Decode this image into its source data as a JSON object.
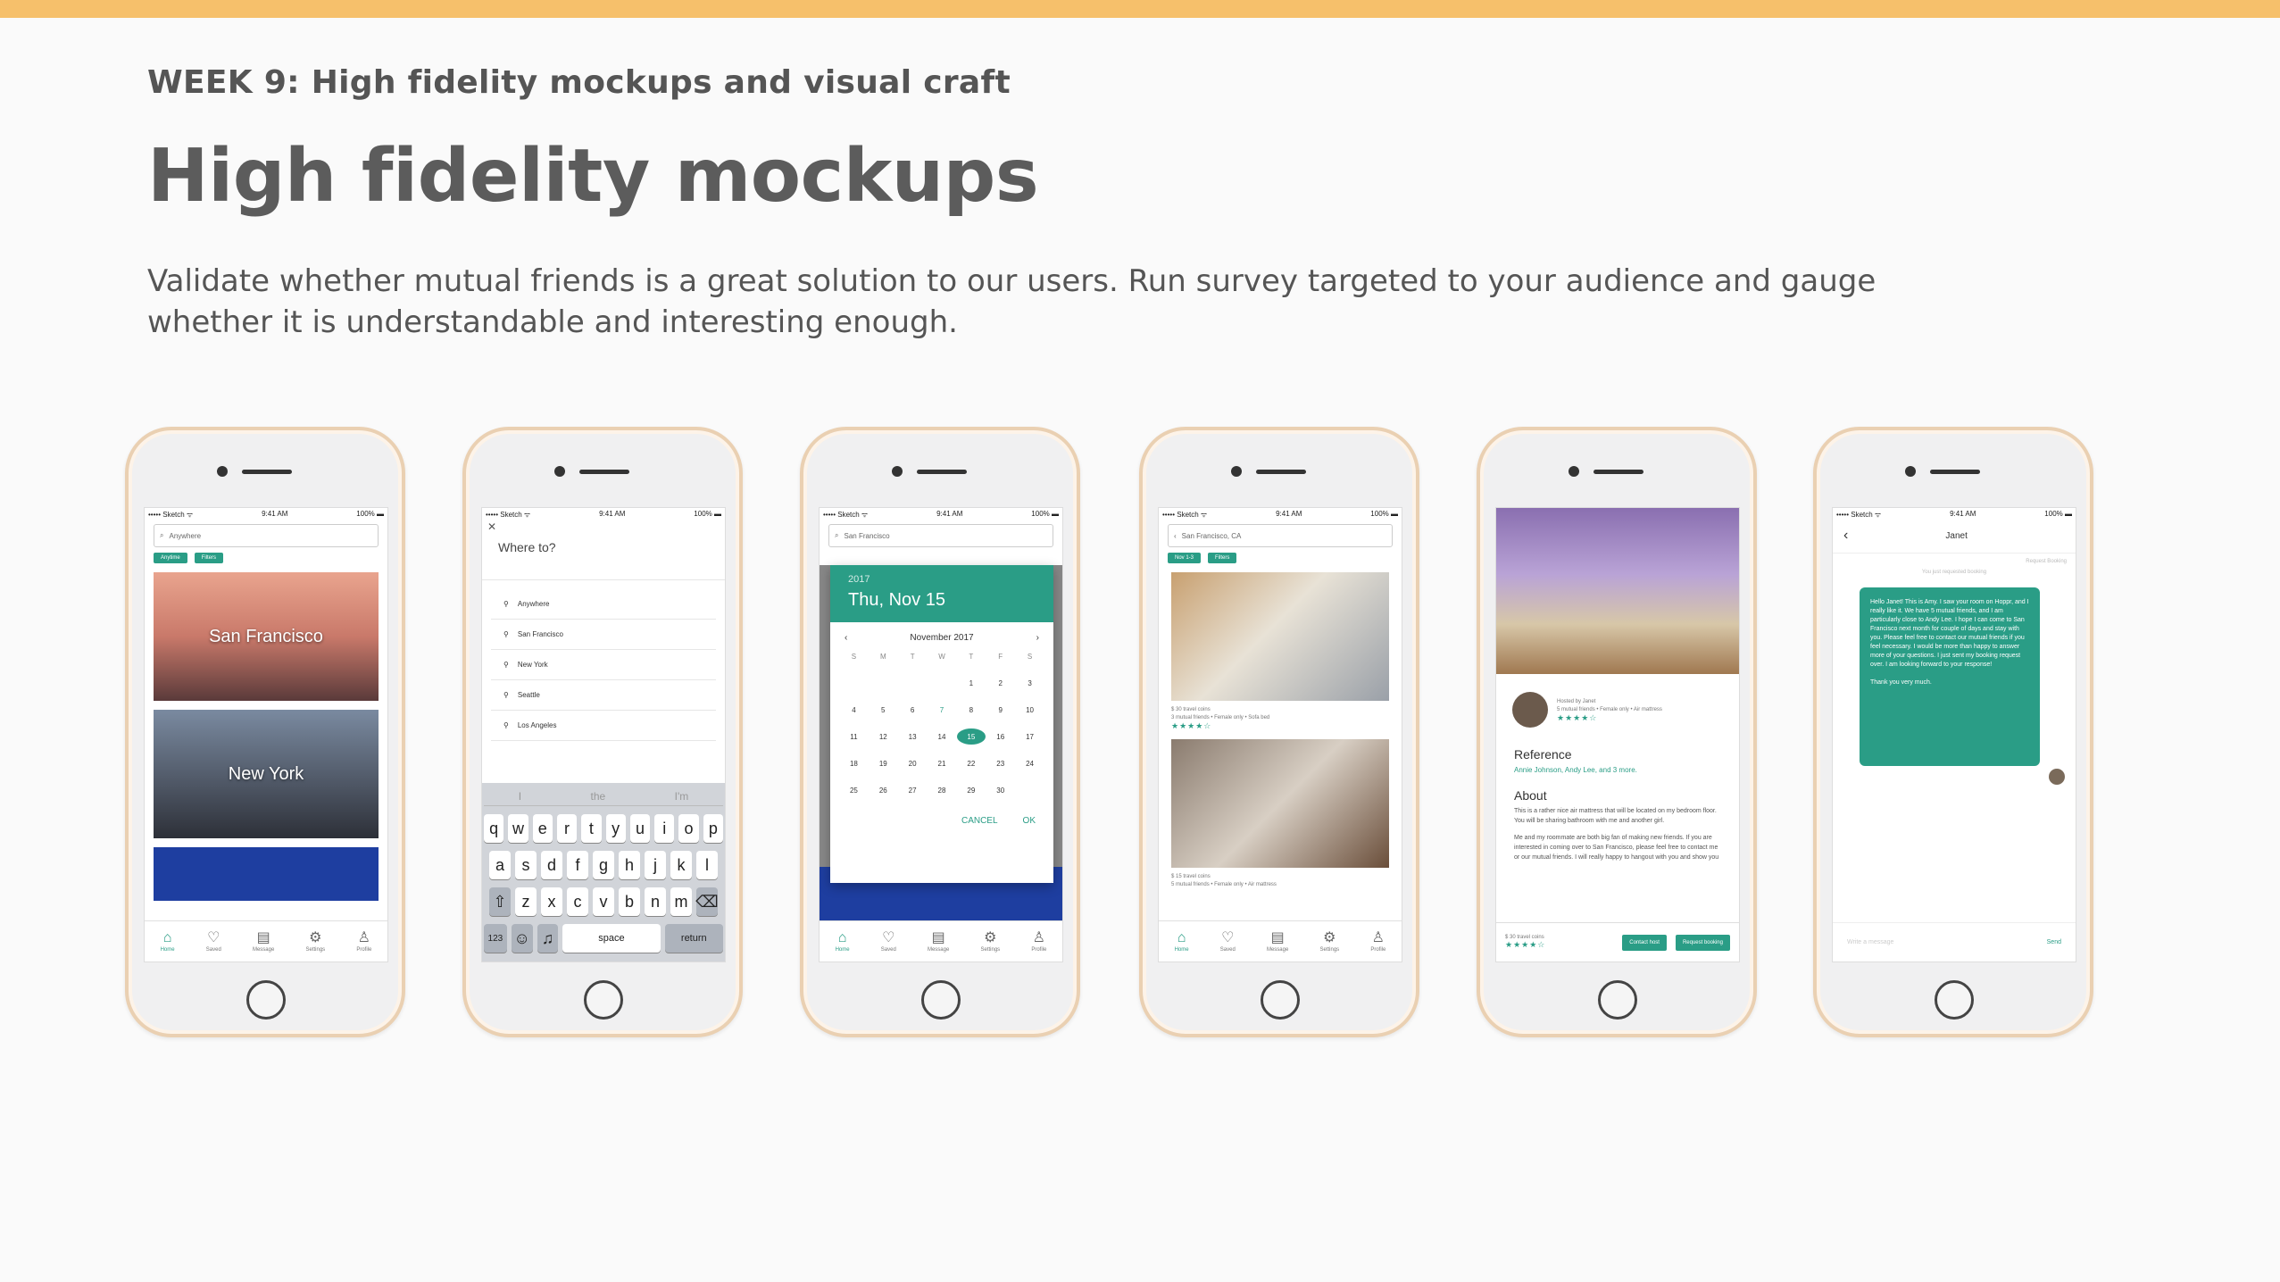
{
  "header": {
    "week": "WEEK 9: High fidelity mockups and visual craft",
    "title": "High fidelity mockups",
    "description": "Validate whether mutual friends is a great solution to our users. Run survey targeted to your audience and gauge whether it is understandable and interesting enough."
  },
  "status": {
    "carrier": "••••• Sketch ᯤ",
    "time": "9:41 AM",
    "battery": "100% ▬"
  },
  "tabbar": {
    "home": "Home",
    "saved": "Saved",
    "message": "Message",
    "settings": "Settings",
    "profile": "Profile"
  },
  "screen1": {
    "search": "Anywhere",
    "chip1": "Anytime",
    "chip2": "Filters",
    "city1": "San Francisco",
    "city2": "New York"
  },
  "screen2": {
    "heading": "Where to?",
    "locations": [
      "Anywhere",
      "San Francisco",
      "New York",
      "Seattle",
      "Los Angeles"
    ],
    "suggestions": [
      "I",
      "the",
      "I'm"
    ],
    "row1": [
      "q",
      "w",
      "e",
      "r",
      "t",
      "y",
      "u",
      "i",
      "o",
      "p"
    ],
    "row2": [
      "a",
      "s",
      "d",
      "f",
      "g",
      "h",
      "j",
      "k",
      "l"
    ],
    "row3": [
      "z",
      "x",
      "c",
      "v",
      "b",
      "n",
      "m"
    ],
    "k123": "123",
    "space": "space",
    "return": "return"
  },
  "screen3": {
    "search": "San Francisco",
    "year": "2017",
    "date": "Thu, Nov 15",
    "month": "November 2017",
    "weekdays": [
      "S",
      "M",
      "T",
      "W",
      "T",
      "F",
      "S"
    ],
    "cancel": "CANCEL",
    "ok": "OK"
  },
  "screen4": {
    "search": "San Francisco, CA",
    "chip1": "Nov 1-3",
    "chip2": "Filters",
    "meta1a": "$ 30 travel coins",
    "meta1b": "3 mutual friends • Female only • Sofa bed",
    "meta2a": "$ 15 travel coins",
    "meta2b": "5 mutual friends • Female only • Air mattress"
  },
  "screen5": {
    "host": "Hosted by Janet",
    "hostmeta": "5 mutual friends • Female only • Air mattress",
    "reference": "Reference",
    "refnames": "Annie Johnson, Andy Lee, and 3 more.",
    "about": "About",
    "about1": "This is a rather nice air mattress that will be located on my bedroom floor. You will be sharing bathroom with me and another girl.",
    "about2": "Me and my roommate are both big fan of making new friends. If you are interested in coming over to San Francisco, please feel free to contact me or our mutual friends. I will really happy to hangout with you and show you",
    "price": "$ 30 travel coins",
    "contact": "Contact host",
    "request": "Request booking"
  },
  "screen6": {
    "name": "Janet",
    "request": "Request Booking",
    "notice": "You just requested booking",
    "message": "Hello Janet! This is Amy. I saw your room on Hoppr, and I really like it. We have 5 mutual friends, and I am particularly close to Andy Lee. I hope I can come to San Francisco next month for couple of days and stay with you. Please feel free to contact our mutual friends if you feel necessary. I would be more than happy to answer more of your questions. I just sent my booking request over. I am looking forward to your response!\n\nThank you very much.",
    "placeholder": "Write a message",
    "send": "Send"
  }
}
